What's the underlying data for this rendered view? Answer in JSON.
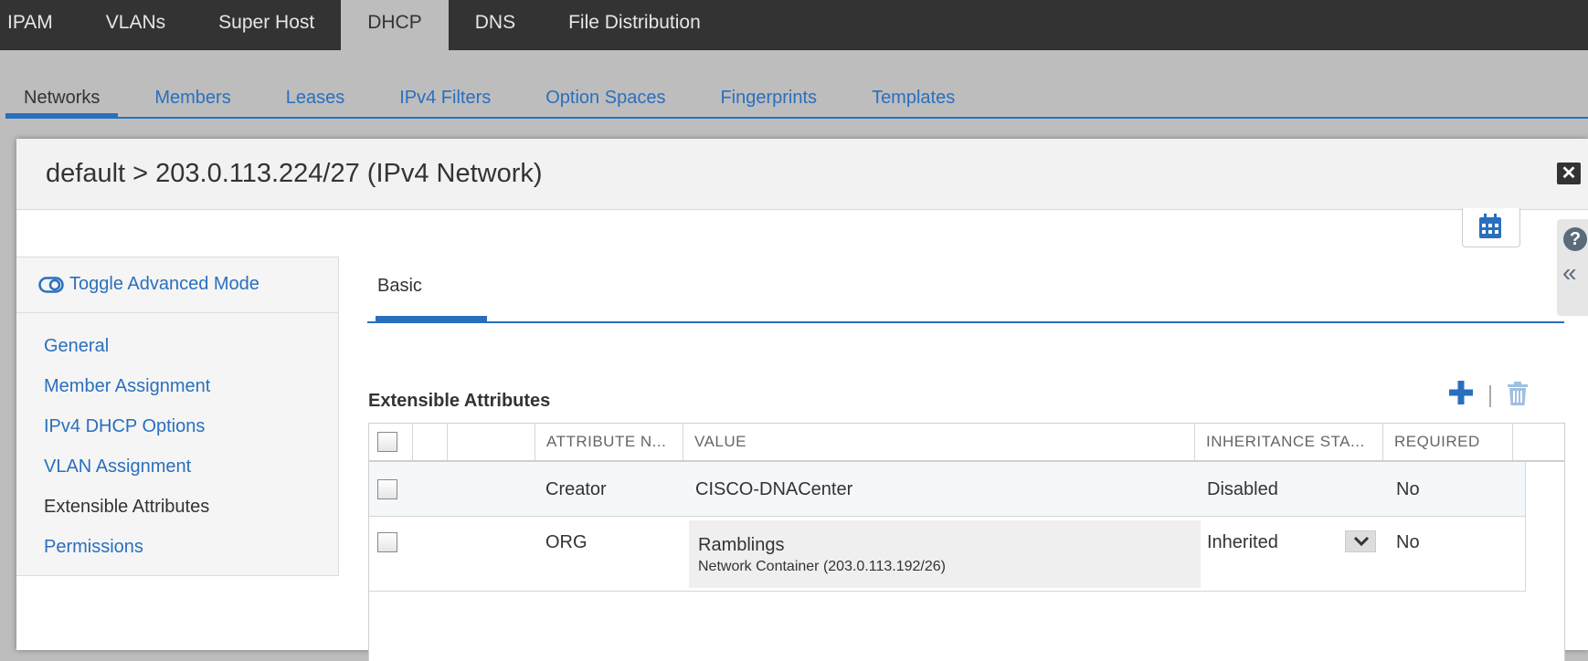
{
  "top_nav": {
    "tabs": [
      {
        "label": "IPAM"
      },
      {
        "label": "VLANs"
      },
      {
        "label": "Super Host"
      },
      {
        "label": "DHCP"
      },
      {
        "label": "DNS"
      },
      {
        "label": "File Distribution"
      }
    ],
    "active": "DHCP"
  },
  "sub_nav": {
    "tabs": [
      {
        "label": "Networks"
      },
      {
        "label": "Members"
      },
      {
        "label": "Leases"
      },
      {
        "label": "IPv4 Filters"
      },
      {
        "label": "Option Spaces"
      },
      {
        "label": "Fingerprints"
      },
      {
        "label": "Templates"
      }
    ],
    "active": "Networks"
  },
  "modal": {
    "title": "default > 203.0.113.224/27 (IPv4 Network)",
    "close_icon": "close-icon",
    "calendar_icon": "calendar-icon",
    "help_icon": "help-icon",
    "collapse_icon": "double-chevron-left-icon"
  },
  "left_panel": {
    "toggle_label": "Toggle Advanced Mode",
    "toggle_icon": "toggle-icon",
    "nav": [
      {
        "label": "General"
      },
      {
        "label": "Member Assignment"
      },
      {
        "label": "IPv4 DHCP Options"
      },
      {
        "label": "VLAN Assignment"
      },
      {
        "label": "Extensible Attributes"
      },
      {
        "label": "Permissions"
      }
    ],
    "current": "Extensible Attributes"
  },
  "content": {
    "tab_label": "Basic",
    "section_title": "Extensible Attributes",
    "add_icon": "plus-icon",
    "delete_icon": "trash-icon",
    "table": {
      "columns": [
        "ATTRIBUTE N...",
        "VALUE",
        "INHERITANCE STA...",
        "REQUIRED"
      ],
      "rows": [
        {
          "attribute": "Creator",
          "value": "CISCO-DNACenter",
          "value_sub": "",
          "inheritance": "Disabled",
          "required": "No"
        },
        {
          "attribute": "ORG",
          "value": "Ramblings",
          "value_sub": "Network Container (203.0.113.192/26)",
          "inheritance": "Inherited",
          "required": "No"
        }
      ]
    }
  },
  "colors": {
    "accent": "#2a6fbe",
    "topbar": "#333333",
    "backdrop": "#bdbdbd"
  }
}
